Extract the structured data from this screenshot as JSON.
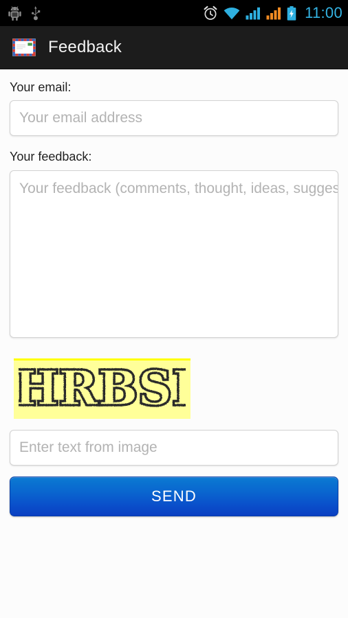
{
  "status_bar": {
    "icons_left": [
      "android-bug-icon",
      "usb-icon"
    ],
    "icons_right": [
      "alarm-clock-icon",
      "wifi-icon",
      "signal-sim1-icon",
      "signal-sim2-icon",
      "battery-charging-icon"
    ],
    "time": "11:00",
    "clock_color": "#34b4e4",
    "background": "#000000"
  },
  "action_bar": {
    "icon": "envelope-airmail-icon",
    "title": "Feedback",
    "background": "#1c1c1c"
  },
  "form": {
    "email_label": "Your email:",
    "email_value": "",
    "email_placeholder": "Your email address",
    "feedback_label": "Your feedback:",
    "feedback_value": "",
    "feedback_placeholder": "Your feedback (comments, thought, ideas, suggestions)",
    "captcha_text": "IHRBSB",
    "captcha_background": "#ffff99",
    "captcha_border": "#ffff00",
    "captcha_input_value": "",
    "captcha_input_placeholder": "Enter text from image",
    "send_label": "SEND",
    "send_color_top": "#0b7ad2",
    "send_color_bottom": "#0b3fc2"
  }
}
